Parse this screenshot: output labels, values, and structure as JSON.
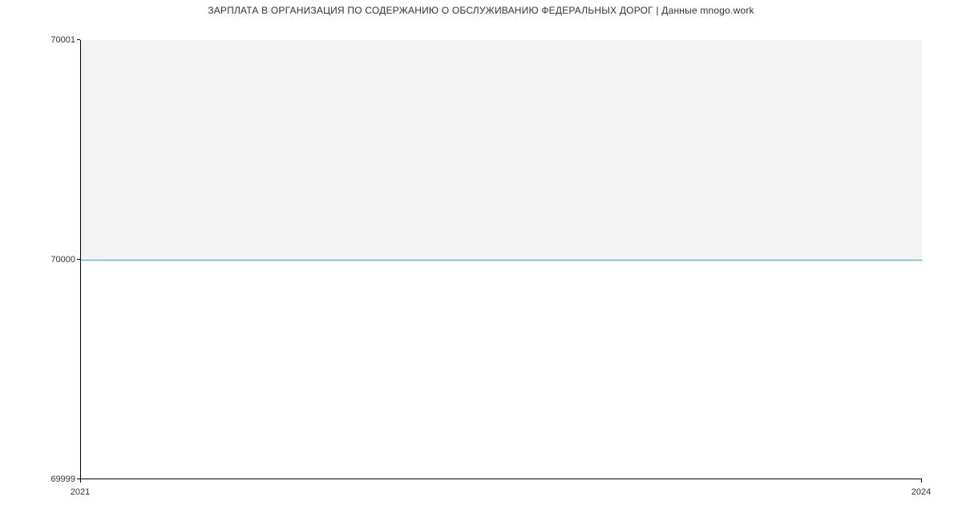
{
  "chart_data": {
    "type": "area",
    "title": "ЗАРПЛАТА В ОРГАНИЗАЦИЯ ПО СОДЕРЖАНИЮ О ОБСЛУЖИВАНИЮ ФЕДЕРАЛЬНЫХ ДОРОГ | Данные mnogo.work",
    "x": [
      2021,
      2024
    ],
    "values": [
      70000,
      70000
    ],
    "ylim": [
      69999,
      70001
    ],
    "xlim": [
      2021,
      2024
    ],
    "yticks": [
      69999,
      70000,
      70001
    ],
    "xticks": [
      2021,
      2024
    ],
    "xlabel": "",
    "ylabel": "",
    "line_color": "#5b8fd6",
    "fill_color": "#f3f3f3"
  },
  "labels": {
    "y0": "69999",
    "y1": "70000",
    "y2": "70001",
    "x0": "2021",
    "x1": "2024"
  }
}
